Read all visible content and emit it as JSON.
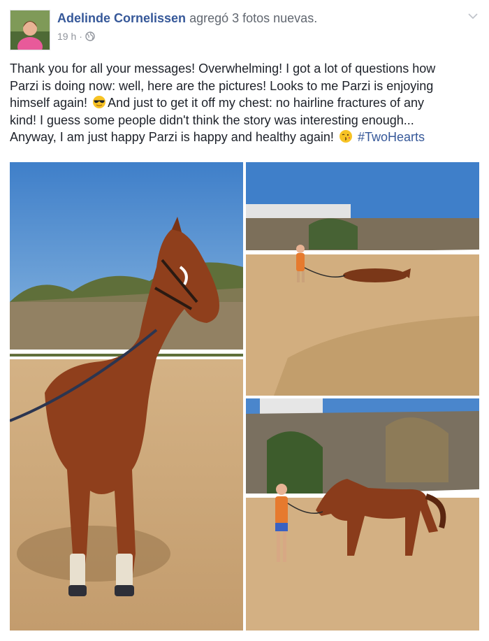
{
  "post": {
    "author": "Adelinde Cornelissen",
    "action": "agregó 3 fotos nuevas.",
    "time": "19 h",
    "separator": "·",
    "text_lines": [
      "Thank you for all your messages! Overwhelming! I got a lot of questions how",
      "Parzi is doing now: well, here are the pictures! Looks to me Parzi is enjoying",
      "himself again!",
      "And just to get it off my chest: no hairline fractures of any",
      "kind! I guess some people didn't think the story was interesting enough...",
      "Anyway, I am just happy Parzi is happy and healthy again!",
      "#TwoHearts"
    ],
    "icons": {
      "privacy": "globe-icon",
      "menu": "chevron-down-icon",
      "emoji_1": "sunglasses-emoji-icon",
      "emoji_2": "kiss-emoji-icon"
    },
    "colors": {
      "link": "#365899",
      "text": "#1d2129",
      "muted": "#90949c"
    }
  }
}
